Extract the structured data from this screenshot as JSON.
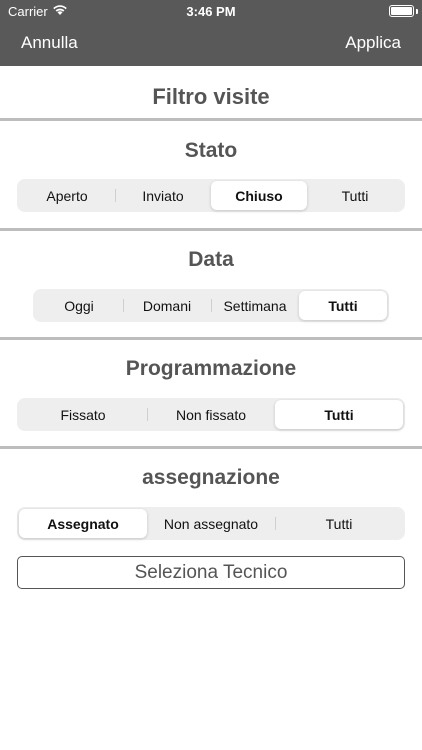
{
  "status_bar": {
    "carrier": "Carrier",
    "time": "3:46 PM"
  },
  "nav": {
    "cancel_label": "Annulla",
    "apply_label": "Applica"
  },
  "page_title": "Filtro visite",
  "sections": {
    "stato": {
      "title": "Stato",
      "options": [
        "Aperto",
        "Inviato",
        "Chiuso",
        "Tutti"
      ],
      "selected": "Chiuso"
    },
    "data": {
      "title": "Data",
      "options": [
        "Oggi",
        "Domani",
        "Settimana",
        "Tutti"
      ],
      "selected": "Tutti"
    },
    "programmazione": {
      "title": "Programmazione",
      "options": [
        "Fissato",
        "Non fissato",
        "Tutti"
      ],
      "selected": "Tutti"
    },
    "assegnazione": {
      "title": "assegnazione",
      "options": [
        "Assegnato",
        "Non assegnato",
        "Tutti"
      ],
      "selected": "Assegnato"
    }
  },
  "technician_button_label": "Seleziona Tecnico",
  "colors": {
    "navbar": "#595959",
    "divider": "#bdbdbd",
    "text": "#555555",
    "segment_bg": "#eeeeef"
  }
}
